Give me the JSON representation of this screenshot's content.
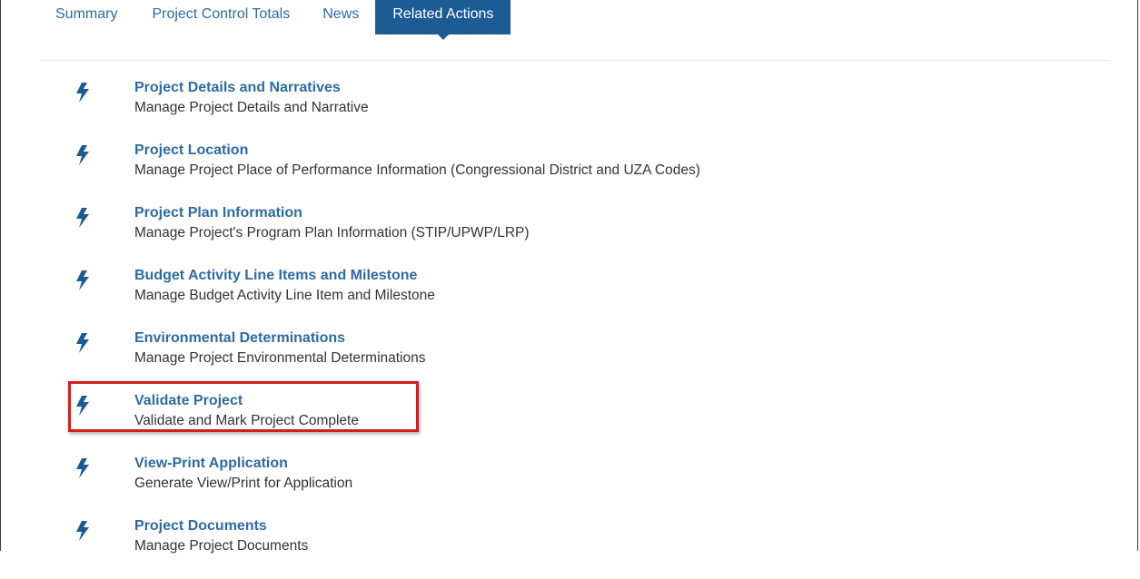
{
  "tabs": [
    {
      "label": "Summary",
      "active": false
    },
    {
      "label": "Project Control Totals",
      "active": false
    },
    {
      "label": "News",
      "active": false
    },
    {
      "label": "Related Actions",
      "active": true
    }
  ],
  "actions": [
    {
      "title": "Project Details and Narratives",
      "description": "Manage Project Details and Narrative",
      "icon": "lightning-bolt-icon"
    },
    {
      "title": "Project Location",
      "description": "Manage Project Place of Performance Information (Congressional District and UZA Codes)",
      "icon": "lightning-bolt-icon"
    },
    {
      "title": "Project Plan Information",
      "description": "Manage Project's Program Plan Information (STIP/UPWP/LRP)",
      "icon": "lightning-bolt-icon"
    },
    {
      "title": "Budget Activity Line Items and Milestone",
      "description": "Manage Budget Activity Line Item and Milestone",
      "icon": "lightning-bolt-icon"
    },
    {
      "title": "Environmental Determinations",
      "description": "Manage Project Environmental Determinations",
      "icon": "lightning-bolt-icon"
    },
    {
      "title": "Validate Project",
      "description": "Validate and Mark Project Complete",
      "icon": "lightning-bolt-icon",
      "highlighted": true
    },
    {
      "title": "View-Print Application",
      "description": "Generate View/Print for Application",
      "icon": "lightning-bolt-icon"
    },
    {
      "title": "Project Documents",
      "description": "Manage Project Documents",
      "icon": "lightning-bolt-icon"
    }
  ],
  "colors": {
    "link": "#2e6aa3",
    "active_tab_bg": "#1d5b94",
    "highlight_border": "#d01f1f",
    "text": "#333333"
  }
}
